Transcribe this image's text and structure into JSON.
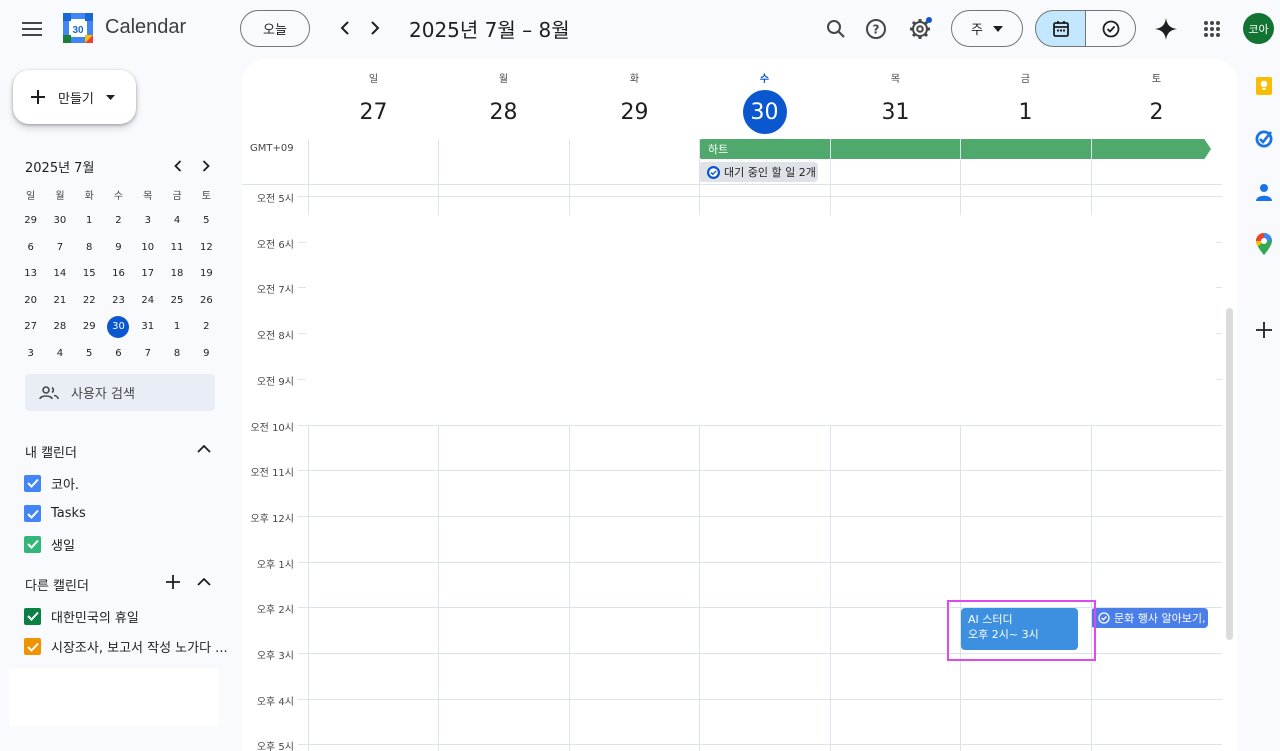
{
  "app": {
    "title": "Calendar",
    "logo_day": "30"
  },
  "header": {
    "today_label": "오늘",
    "range_title": "2025년 7월 – 8월",
    "view_label": "주",
    "avatar_text": "코아"
  },
  "sidebar": {
    "create_label": "만들기",
    "mini": {
      "title": "2025년 7월",
      "weekdays": [
        "일",
        "월",
        "화",
        "수",
        "목",
        "금",
        "토"
      ],
      "weeks": [
        [
          "29",
          "30",
          "1",
          "2",
          "3",
          "4",
          "5"
        ],
        [
          "6",
          "7",
          "8",
          "9",
          "10",
          "11",
          "12"
        ],
        [
          "13",
          "14",
          "15",
          "16",
          "17",
          "18",
          "19"
        ],
        [
          "20",
          "21",
          "22",
          "23",
          "24",
          "25",
          "26"
        ],
        [
          "27",
          "28",
          "29",
          "30",
          "31",
          "1",
          "2"
        ],
        [
          "3",
          "4",
          "5",
          "6",
          "7",
          "8",
          "9"
        ]
      ]
    },
    "people_search": "사용자 검색",
    "my_calendars_title": "내 캘린더",
    "my_calendars": [
      {
        "label": "코아.",
        "color": "#4285f4"
      },
      {
        "label": "Tasks",
        "color": "#4285f4"
      },
      {
        "label": "생일",
        "color": "#33b679"
      }
    ],
    "other_calendars_title": "다른 캘린더",
    "other_calendars": [
      {
        "label": "대한민국의 휴일",
        "color": "#0b8043"
      },
      {
        "label": "시장조사, 보고서 작성 노가다 ...",
        "color": "#f09300"
      }
    ]
  },
  "week": {
    "days": [
      {
        "name": "일",
        "num": "27"
      },
      {
        "name": "월",
        "num": "28"
      },
      {
        "name": "화",
        "num": "29"
      },
      {
        "name": "수",
        "num": "30"
      },
      {
        "name": "목",
        "num": "31"
      },
      {
        "name": "금",
        "num": "1"
      },
      {
        "name": "토",
        "num": "2"
      }
    ],
    "timezone": "GMT+09",
    "hours": [
      "오전 5시",
      "오전 6시",
      "오전 7시",
      "오전 8시",
      "오전 9시",
      "오전 10시",
      "오전 11시",
      "오후 12시",
      "오후 1시",
      "오후 2시",
      "오후 3시",
      "오후 4시",
      "오후 5시"
    ],
    "allday_event": "하트",
    "allday_task": "대기 중인 할 일 2개",
    "events": {
      "ai_title": "AI 스터디",
      "ai_time": "오후 2시~ 3시",
      "culture_title": "문화 행사 알아보기,"
    }
  },
  "colors": {
    "accent": "#0b57d0",
    "allday": "#4fa86c",
    "event": "#3d8fe0",
    "highlight": "#e048f0"
  }
}
